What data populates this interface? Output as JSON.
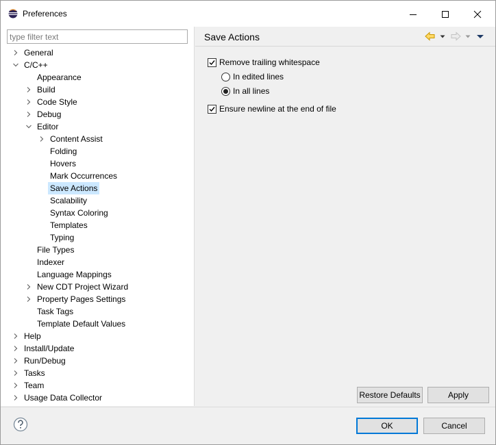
{
  "window": {
    "title": "Preferences",
    "minimize_icon": "minimize-icon",
    "maximize_icon": "maximize-icon",
    "close_icon": "close-icon"
  },
  "filter": {
    "placeholder": "type filter text",
    "value": ""
  },
  "tree": {
    "items": [
      {
        "label": "General",
        "level": 0,
        "expander": "collapsed",
        "selected": false
      },
      {
        "label": "C/C++",
        "level": 0,
        "expander": "expanded",
        "selected": false
      },
      {
        "label": "Appearance",
        "level": 1,
        "expander": "none",
        "selected": false
      },
      {
        "label": "Build",
        "level": 1,
        "expander": "collapsed",
        "selected": false
      },
      {
        "label": "Code Style",
        "level": 1,
        "expander": "collapsed",
        "selected": false
      },
      {
        "label": "Debug",
        "level": 1,
        "expander": "collapsed",
        "selected": false
      },
      {
        "label": "Editor",
        "level": 1,
        "expander": "expanded",
        "selected": false
      },
      {
        "label": "Content Assist",
        "level": 2,
        "expander": "collapsed",
        "selected": false
      },
      {
        "label": "Folding",
        "level": 2,
        "expander": "none",
        "selected": false
      },
      {
        "label": "Hovers",
        "level": 2,
        "expander": "none",
        "selected": false
      },
      {
        "label": "Mark Occurrences",
        "level": 2,
        "expander": "none",
        "selected": false
      },
      {
        "label": "Save Actions",
        "level": 2,
        "expander": "none",
        "selected": true
      },
      {
        "label": "Scalability",
        "level": 2,
        "expander": "none",
        "selected": false
      },
      {
        "label": "Syntax Coloring",
        "level": 2,
        "expander": "none",
        "selected": false
      },
      {
        "label": "Templates",
        "level": 2,
        "expander": "none",
        "selected": false
      },
      {
        "label": "Typing",
        "level": 2,
        "expander": "none",
        "selected": false
      },
      {
        "label": "File Types",
        "level": 1,
        "expander": "none",
        "selected": false
      },
      {
        "label": "Indexer",
        "level": 1,
        "expander": "none",
        "selected": false
      },
      {
        "label": "Language Mappings",
        "level": 1,
        "expander": "none",
        "selected": false
      },
      {
        "label": "New CDT Project Wizard",
        "level": 1,
        "expander": "collapsed",
        "selected": false
      },
      {
        "label": "Property Pages Settings",
        "level": 1,
        "expander": "collapsed",
        "selected": false
      },
      {
        "label": "Task Tags",
        "level": 1,
        "expander": "none",
        "selected": false
      },
      {
        "label": "Template Default Values",
        "level": 1,
        "expander": "none",
        "selected": false
      },
      {
        "label": "Help",
        "level": 0,
        "expander": "collapsed",
        "selected": false
      },
      {
        "label": "Install/Update",
        "level": 0,
        "expander": "collapsed",
        "selected": false
      },
      {
        "label": "Run/Debug",
        "level": 0,
        "expander": "collapsed",
        "selected": false
      },
      {
        "label": "Tasks",
        "level": 0,
        "expander": "collapsed",
        "selected": false
      },
      {
        "label": "Team",
        "level": 0,
        "expander": "collapsed",
        "selected": false
      },
      {
        "label": "Usage Data Collector",
        "level": 0,
        "expander": "collapsed",
        "selected": false
      }
    ]
  },
  "page": {
    "title": "Save Actions",
    "nav_icons": [
      "back-arrow-icon",
      "back-menu-icon",
      "forward-arrow-icon",
      "forward-menu-icon",
      "view-menu-icon"
    ]
  },
  "options": {
    "remove_trailing": {
      "label": "Remove trailing whitespace",
      "checked": true
    },
    "in_edited_lines": {
      "label": "In edited lines",
      "selected": false
    },
    "in_all_lines": {
      "label": "In all lines",
      "selected": true
    },
    "ensure_newline": {
      "label": "Ensure newline at the end of file",
      "checked": true
    }
  },
  "buttons": {
    "restore_defaults": "Restore Defaults",
    "apply": "Apply",
    "ok": "OK",
    "cancel": "Cancel"
  },
  "footer": {
    "help_icon": "help-icon"
  },
  "colors": {
    "selection": "#cce8ff",
    "default_button_border": "#0078d7",
    "back_arrow": "#e8b800"
  }
}
